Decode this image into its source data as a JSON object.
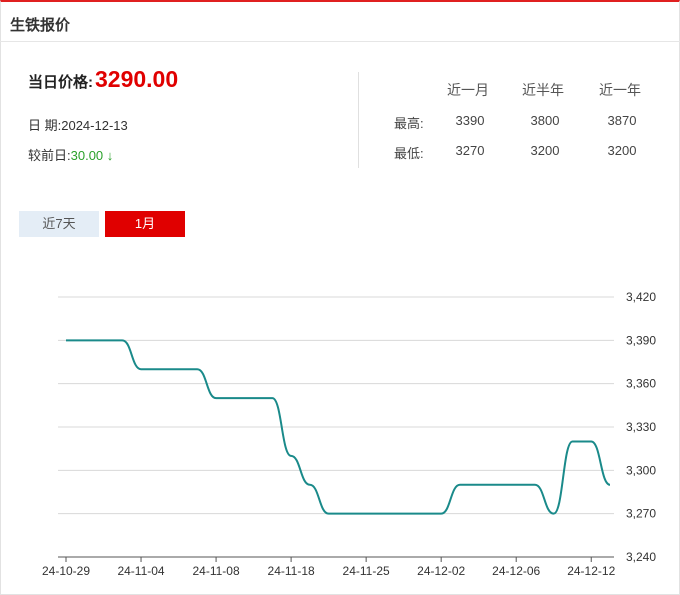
{
  "header": {
    "title": "生铁报价"
  },
  "price": {
    "label": "当日价格:",
    "value": "3290.00"
  },
  "date": {
    "label": "日  期:",
    "value": "2024-12-13"
  },
  "change": {
    "label": "较前日:",
    "value": "30.00",
    "arrow": "↓"
  },
  "stats": {
    "headers": [
      "近一月",
      "近半年",
      "近一年"
    ],
    "rows": [
      {
        "label": "最高:",
        "values": [
          "3390",
          "3800",
          "3870"
        ]
      },
      {
        "label": "最低:",
        "values": [
          "3270",
          "3200",
          "3200"
        ]
      }
    ]
  },
  "tabs": [
    {
      "label": "近7天",
      "active": false
    },
    {
      "label": "1月",
      "active": true
    }
  ],
  "colors": {
    "accent": "#e00000",
    "line": "#1a8a8a",
    "grid": "#d8d8d8",
    "down": "#2aa12a"
  },
  "chart_data": {
    "type": "line",
    "ylim": [
      3240,
      3420
    ],
    "yticks": [
      "3,240",
      "3,270",
      "3,300",
      "3,330",
      "3,360",
      "3,390",
      "3,420"
    ],
    "ytick_values": [
      3240,
      3270,
      3300,
      3330,
      3360,
      3390,
      3420
    ],
    "xtick_labels": [
      "24-10-29",
      "24-11-04",
      "24-11-08",
      "24-11-18",
      "24-11-25",
      "24-12-02",
      "24-12-06",
      "24-12-12"
    ],
    "xtick_index": [
      0,
      4,
      8,
      12,
      16,
      20,
      24,
      28
    ],
    "x": [
      "24-10-29",
      "24-10-30",
      "24-10-31",
      "24-11-01",
      "24-11-04",
      "24-11-05",
      "24-11-06",
      "24-11-07",
      "24-11-08",
      "24-11-11",
      "24-11-12",
      "24-11-13",
      "24-11-18",
      "24-11-19",
      "24-11-20",
      "24-11-21",
      "24-11-25",
      "24-11-26",
      "24-11-27",
      "24-11-28",
      "24-12-02",
      "24-12-03",
      "24-12-04",
      "24-12-05",
      "24-12-06",
      "24-12-09",
      "24-12-10",
      "24-12-11",
      "24-12-12",
      "24-12-13"
    ],
    "values": [
      3390,
      3390,
      3390,
      3390,
      3370,
      3370,
      3370,
      3370,
      3350,
      3350,
      3350,
      3350,
      3310,
      3290,
      3270,
      3270,
      3270,
      3270,
      3270,
      3270,
      3270,
      3290,
      3290,
      3290,
      3290,
      3290,
      3270,
      3320,
      3320,
      3290
    ],
    "series": [
      {
        "name": "",
        "values": [
          3390,
          3390,
          3390,
          3390,
          3370,
          3370,
          3370,
          3370,
          3350,
          3350,
          3350,
          3350,
          3310,
          3290,
          3270,
          3270,
          3270,
          3270,
          3270,
          3270,
          3270,
          3290,
          3290,
          3290,
          3290,
          3290,
          3270,
          3320,
          3320,
          3290
        ]
      }
    ]
  }
}
